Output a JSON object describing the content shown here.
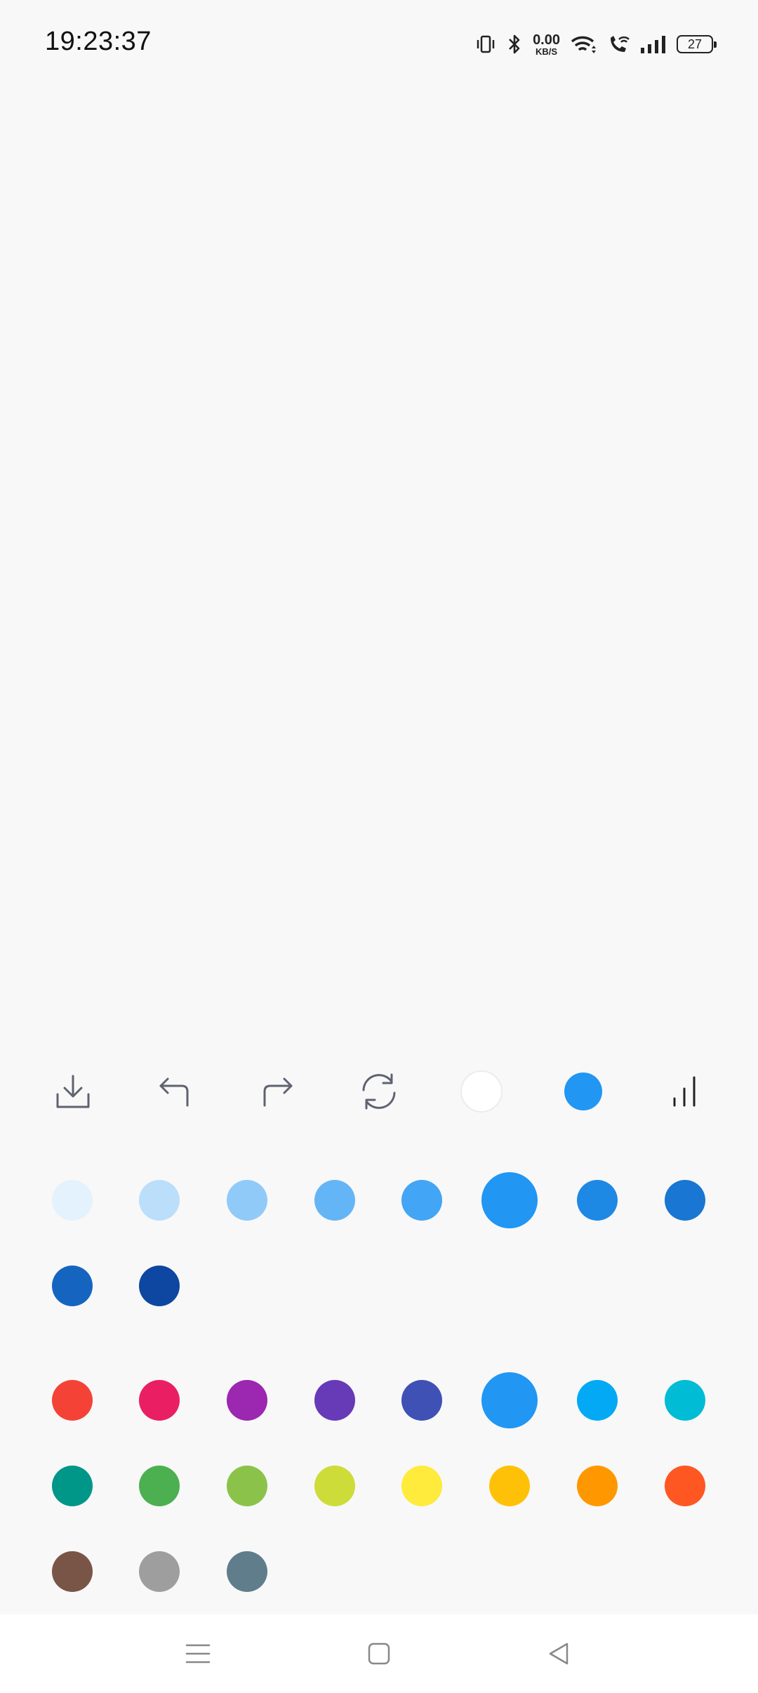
{
  "status_bar": {
    "time": "19:23:37",
    "net_speed_value": "0.00",
    "net_speed_unit": "KB/S",
    "battery_level": "27",
    "icons": [
      "vibrate-icon",
      "bluetooth-icon",
      "wifi-icon",
      "wifi-calling-icon",
      "cellular-signal-icon",
      "battery-icon"
    ]
  },
  "toolbar": {
    "tools": [
      "save-icon",
      "undo-icon",
      "redo-icon",
      "reset-icon",
      "eraser-icon",
      "current-color-icon",
      "brush-size-icon"
    ],
    "current_color": "#2196F3",
    "eraser_color": "#ffffff"
  },
  "shade_palette": {
    "colors": [
      "#E3F2FD",
      "#BBDEFB",
      "#90CAF9",
      "#64B5F6",
      "#42A5F5",
      "#2196F3",
      "#1E88E5",
      "#1976D2",
      "#1565C0",
      "#0D47A1"
    ],
    "selected_index": 5
  },
  "main_palette": {
    "colors": [
      "#F44336",
      "#E91E63",
      "#9C27B0",
      "#673AB7",
      "#3F51B5",
      "#2196F3",
      "#03A9F4",
      "#00BCD4",
      "#009688",
      "#4CAF50",
      "#8BC34A",
      "#CDDC39",
      "#FFEB3B",
      "#FFC107",
      "#FF9800",
      "#FF5722",
      "#795548",
      "#9E9E9E",
      "#607D8B"
    ],
    "selected_index": 5
  },
  "nav_bar": {
    "buttons": [
      "menu-icon",
      "home-icon",
      "back-icon"
    ]
  }
}
